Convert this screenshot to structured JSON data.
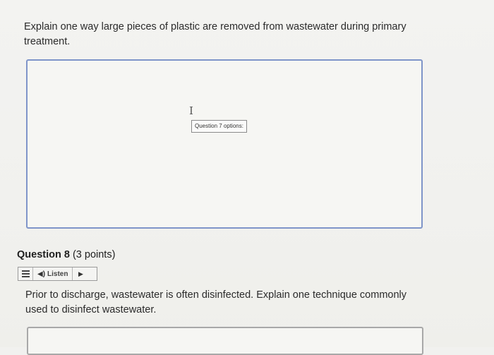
{
  "question7": {
    "prompt": "Explain one way large pieces of plastic are removed from wastewater during primary treatment.",
    "tooltip": "Question 7 options:",
    "cursor_icon": "text-cursor-icon"
  },
  "question8": {
    "number": "Question 8",
    "points": "(3 points)",
    "listen_label": "Listen",
    "prompt": "Prior to discharge, wastewater is often disinfected. Explain one technique commonly used to disinfect wastewater."
  },
  "colors": {
    "focus_border": "#7f95c9",
    "background": "#f1f1ef"
  }
}
